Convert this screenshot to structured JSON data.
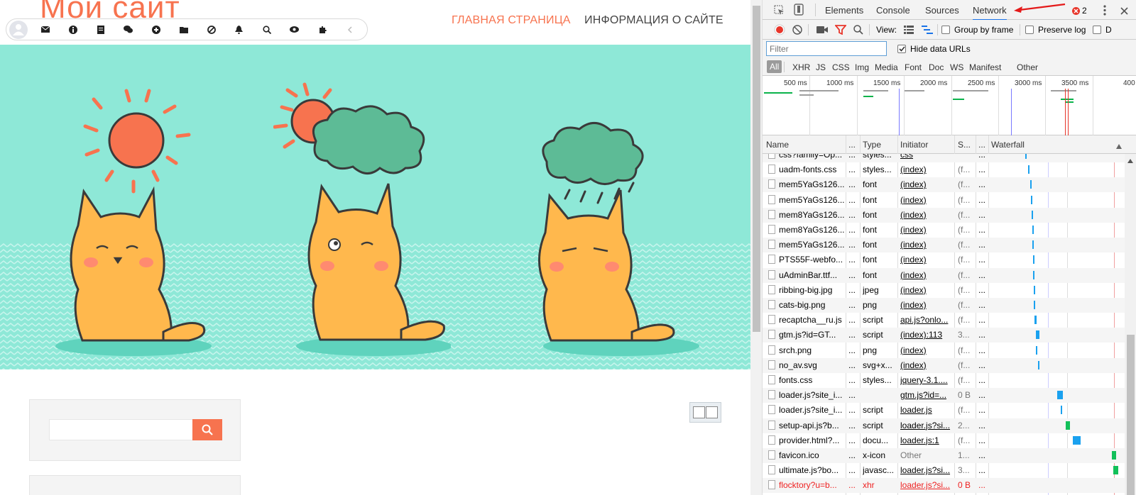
{
  "site": {
    "logo_text": "Мой сайт",
    "nav_home": "ГЛАВНАЯ СТРАНИЦА",
    "nav_info": "ИНФОРМАЦИЯ О САЙТЕ"
  },
  "devtools": {
    "tabs": [
      "Elements",
      "Console",
      "Sources",
      "Network"
    ],
    "active_tab": "Network",
    "error_count": "2",
    "toolbar": {
      "view_label": "View:",
      "group_by_frame": "Group by frame",
      "preserve_log": "Preserve log",
      "disable_cache": "D"
    },
    "filter_placeholder": "Filter",
    "hide_data_urls": "Hide data URLs",
    "types": [
      "All",
      "XHR",
      "JS",
      "CSS",
      "Img",
      "Media",
      "Font",
      "Doc",
      "WS",
      "Manifest",
      "Other"
    ],
    "overview_ticks": [
      "500 ms",
      "1000 ms",
      "1500 ms",
      "2000 ms",
      "2500 ms",
      "3000 ms",
      "3500 ms",
      "400"
    ],
    "columns": {
      "name": "Name",
      "dots1": "...",
      "type": "Type",
      "initiator": "Initiator",
      "size": "S...",
      "dots2": "...",
      "waterfall": "Waterfall"
    },
    "rows": [
      {
        "name": "css?family=Op...",
        "dots": "...",
        "type": "styles...",
        "initiator": "css",
        "size": "",
        "dots2": "...",
        "icon": "file"
      },
      {
        "name": "uadm-fonts.css",
        "dots": "...",
        "type": "styles...",
        "initiator": "(index)",
        "size": "(f...",
        "dots2": "...",
        "icon": "file"
      },
      {
        "name": "mem5YaGs126...",
        "dots": "...",
        "type": "font",
        "initiator": "(index)",
        "size": "(f...",
        "dots2": "...",
        "icon": "file"
      },
      {
        "name": "mem5YaGs126...",
        "dots": "...",
        "type": "font",
        "initiator": "(index)",
        "size": "(f...",
        "dots2": "...",
        "icon": "file"
      },
      {
        "name": "mem8YaGs126...",
        "dots": "...",
        "type": "font",
        "initiator": "(index)",
        "size": "(f...",
        "dots2": "...",
        "icon": "file"
      },
      {
        "name": "mem8YaGs126...",
        "dots": "...",
        "type": "font",
        "initiator": "(index)",
        "size": "(f...",
        "dots2": "...",
        "icon": "file"
      },
      {
        "name": "mem5YaGs126...",
        "dots": "...",
        "type": "font",
        "initiator": "(index)",
        "size": "(f...",
        "dots2": "...",
        "icon": "file"
      },
      {
        "name": "PTS55F-webfo...",
        "dots": "...",
        "type": "font",
        "initiator": "(index)",
        "size": "(f...",
        "dots2": "...",
        "icon": "file"
      },
      {
        "name": "uAdminBar.ttf...",
        "dots": "...",
        "type": "font",
        "initiator": "(index)",
        "size": "(f...",
        "dots2": "...",
        "icon": "file"
      },
      {
        "name": "ribbing-big.jpg",
        "dots": "...",
        "type": "jpeg",
        "initiator": "(index)",
        "size": "(f...",
        "dots2": "...",
        "icon": "image"
      },
      {
        "name": "cats-big.png",
        "dots": "...",
        "type": "png",
        "initiator": "(index)",
        "size": "(f...",
        "dots2": "...",
        "icon": "image"
      },
      {
        "name": "recaptcha__ru.js",
        "dots": "...",
        "type": "script",
        "initiator": "api.js?onlo...",
        "size": "(f...",
        "dots2": "...",
        "icon": "file"
      },
      {
        "name": "gtm.js?id=GT...",
        "dots": "...",
        "type": "script",
        "initiator": "(index):113",
        "size": "3...",
        "dots2": "...",
        "icon": "file"
      },
      {
        "name": "srch.png",
        "dots": "...",
        "type": "png",
        "initiator": "(index)",
        "size": "(f...",
        "dots2": "...",
        "icon": "file"
      },
      {
        "name": "no_av.svg",
        "dots": "...",
        "type": "svg+x...",
        "initiator": "(index)",
        "size": "(f...",
        "dots2": "...",
        "icon": "file"
      },
      {
        "name": "fonts.css",
        "dots": "...",
        "type": "styles...",
        "initiator": "jquery-3.1....",
        "size": "(f...",
        "dots2": "...",
        "icon": "file"
      },
      {
        "name": "loader.js?site_i...",
        "dots": "...",
        "type": "",
        "initiator": "gtm.js?id=...",
        "size": "0 B",
        "dots2": "...",
        "icon": "file"
      },
      {
        "name": "loader.js?site_i...",
        "dots": "...",
        "type": "script",
        "initiator": "loader.js",
        "size": "(f...",
        "dots2": "...",
        "icon": "file"
      },
      {
        "name": "setup-api.js?b...",
        "dots": "...",
        "type": "script",
        "initiator": "loader.js?si...",
        "size": "2...",
        "dots2": "...",
        "icon": "file"
      },
      {
        "name": "provider.html?...",
        "dots": "...",
        "type": "docu...",
        "initiator": "loader.js:1",
        "size": "(f...",
        "dots2": "...",
        "icon": "file"
      },
      {
        "name": "favicon.ico",
        "dots": "...",
        "type": "x-icon",
        "initiator": "Other",
        "size": "1...",
        "dots2": "...",
        "icon": "file"
      },
      {
        "name": "ultimate.js?bo...",
        "dots": "...",
        "type": "javasc...",
        "initiator": "loader.js?si...",
        "size": "3...",
        "dots2": "...",
        "icon": "image"
      },
      {
        "name": "flocktory?u=b...",
        "dots": "...",
        "type": "xhr",
        "initiator": "loader.js?si...",
        "size": "0 B",
        "dots2": "...",
        "icon": "file",
        "error": true
      }
    ]
  }
}
